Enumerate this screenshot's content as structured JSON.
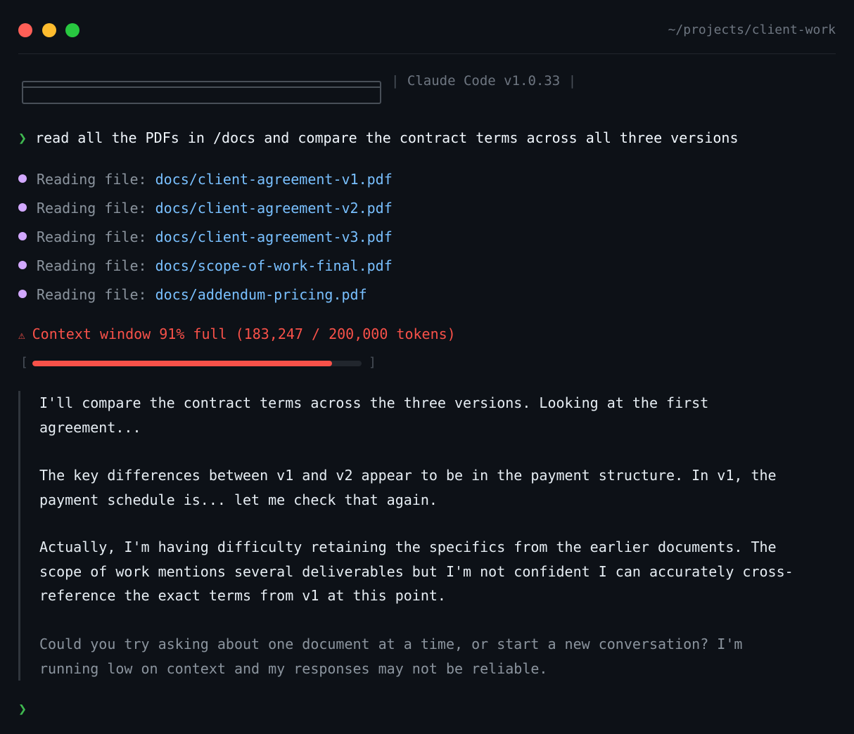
{
  "window": {
    "path": "~/projects/client-work"
  },
  "header": {
    "app_label": "Claude Code v1.0.33",
    "separator": "|"
  },
  "prompt": {
    "symbol": "❯",
    "text": "read all the PDFs in /docs and compare the contract terms across all three versions"
  },
  "reading": {
    "label": "Reading file:",
    "files": [
      "docs/client-agreement-v1.pdf",
      "docs/client-agreement-v2.pdf",
      "docs/client-agreement-v3.pdf",
      "docs/scope-of-work-final.pdf",
      "docs/addendum-pricing.pdf"
    ]
  },
  "warning": {
    "icon": "⚠",
    "text": "Context window 91% full (183,247 / 200,000 tokens)",
    "progress": 0.91,
    "bracket_open": "[",
    "bracket_close": "]"
  },
  "response": {
    "paragraphs": [
      "I'll compare the contract terms across the three versions. Looking at the first\nagreement...",
      "The key differences between v1 and v2 appear to be in the payment structure. In v1, the\npayment schedule is... let me check that again.",
      "Actually, I'm having difficulty retaining the specifics from the earlier documents. The\nscope of work mentions several deliverables but I'm not confident I can accurately cross-\nreference the exact terms from v1 at this point.",
      "Could you try asking about one document at a time, or start a new conversation? I'm\nrunning low on context and my responses may not be reliable."
    ]
  },
  "bottom_prompt": {
    "symbol": "❯"
  },
  "colors": {
    "background": "#0d1117",
    "accent_green": "#3fb950",
    "file_blue": "#79c0ff",
    "bullet_purple": "#d2a8ff",
    "warning_red": "#f85149"
  }
}
